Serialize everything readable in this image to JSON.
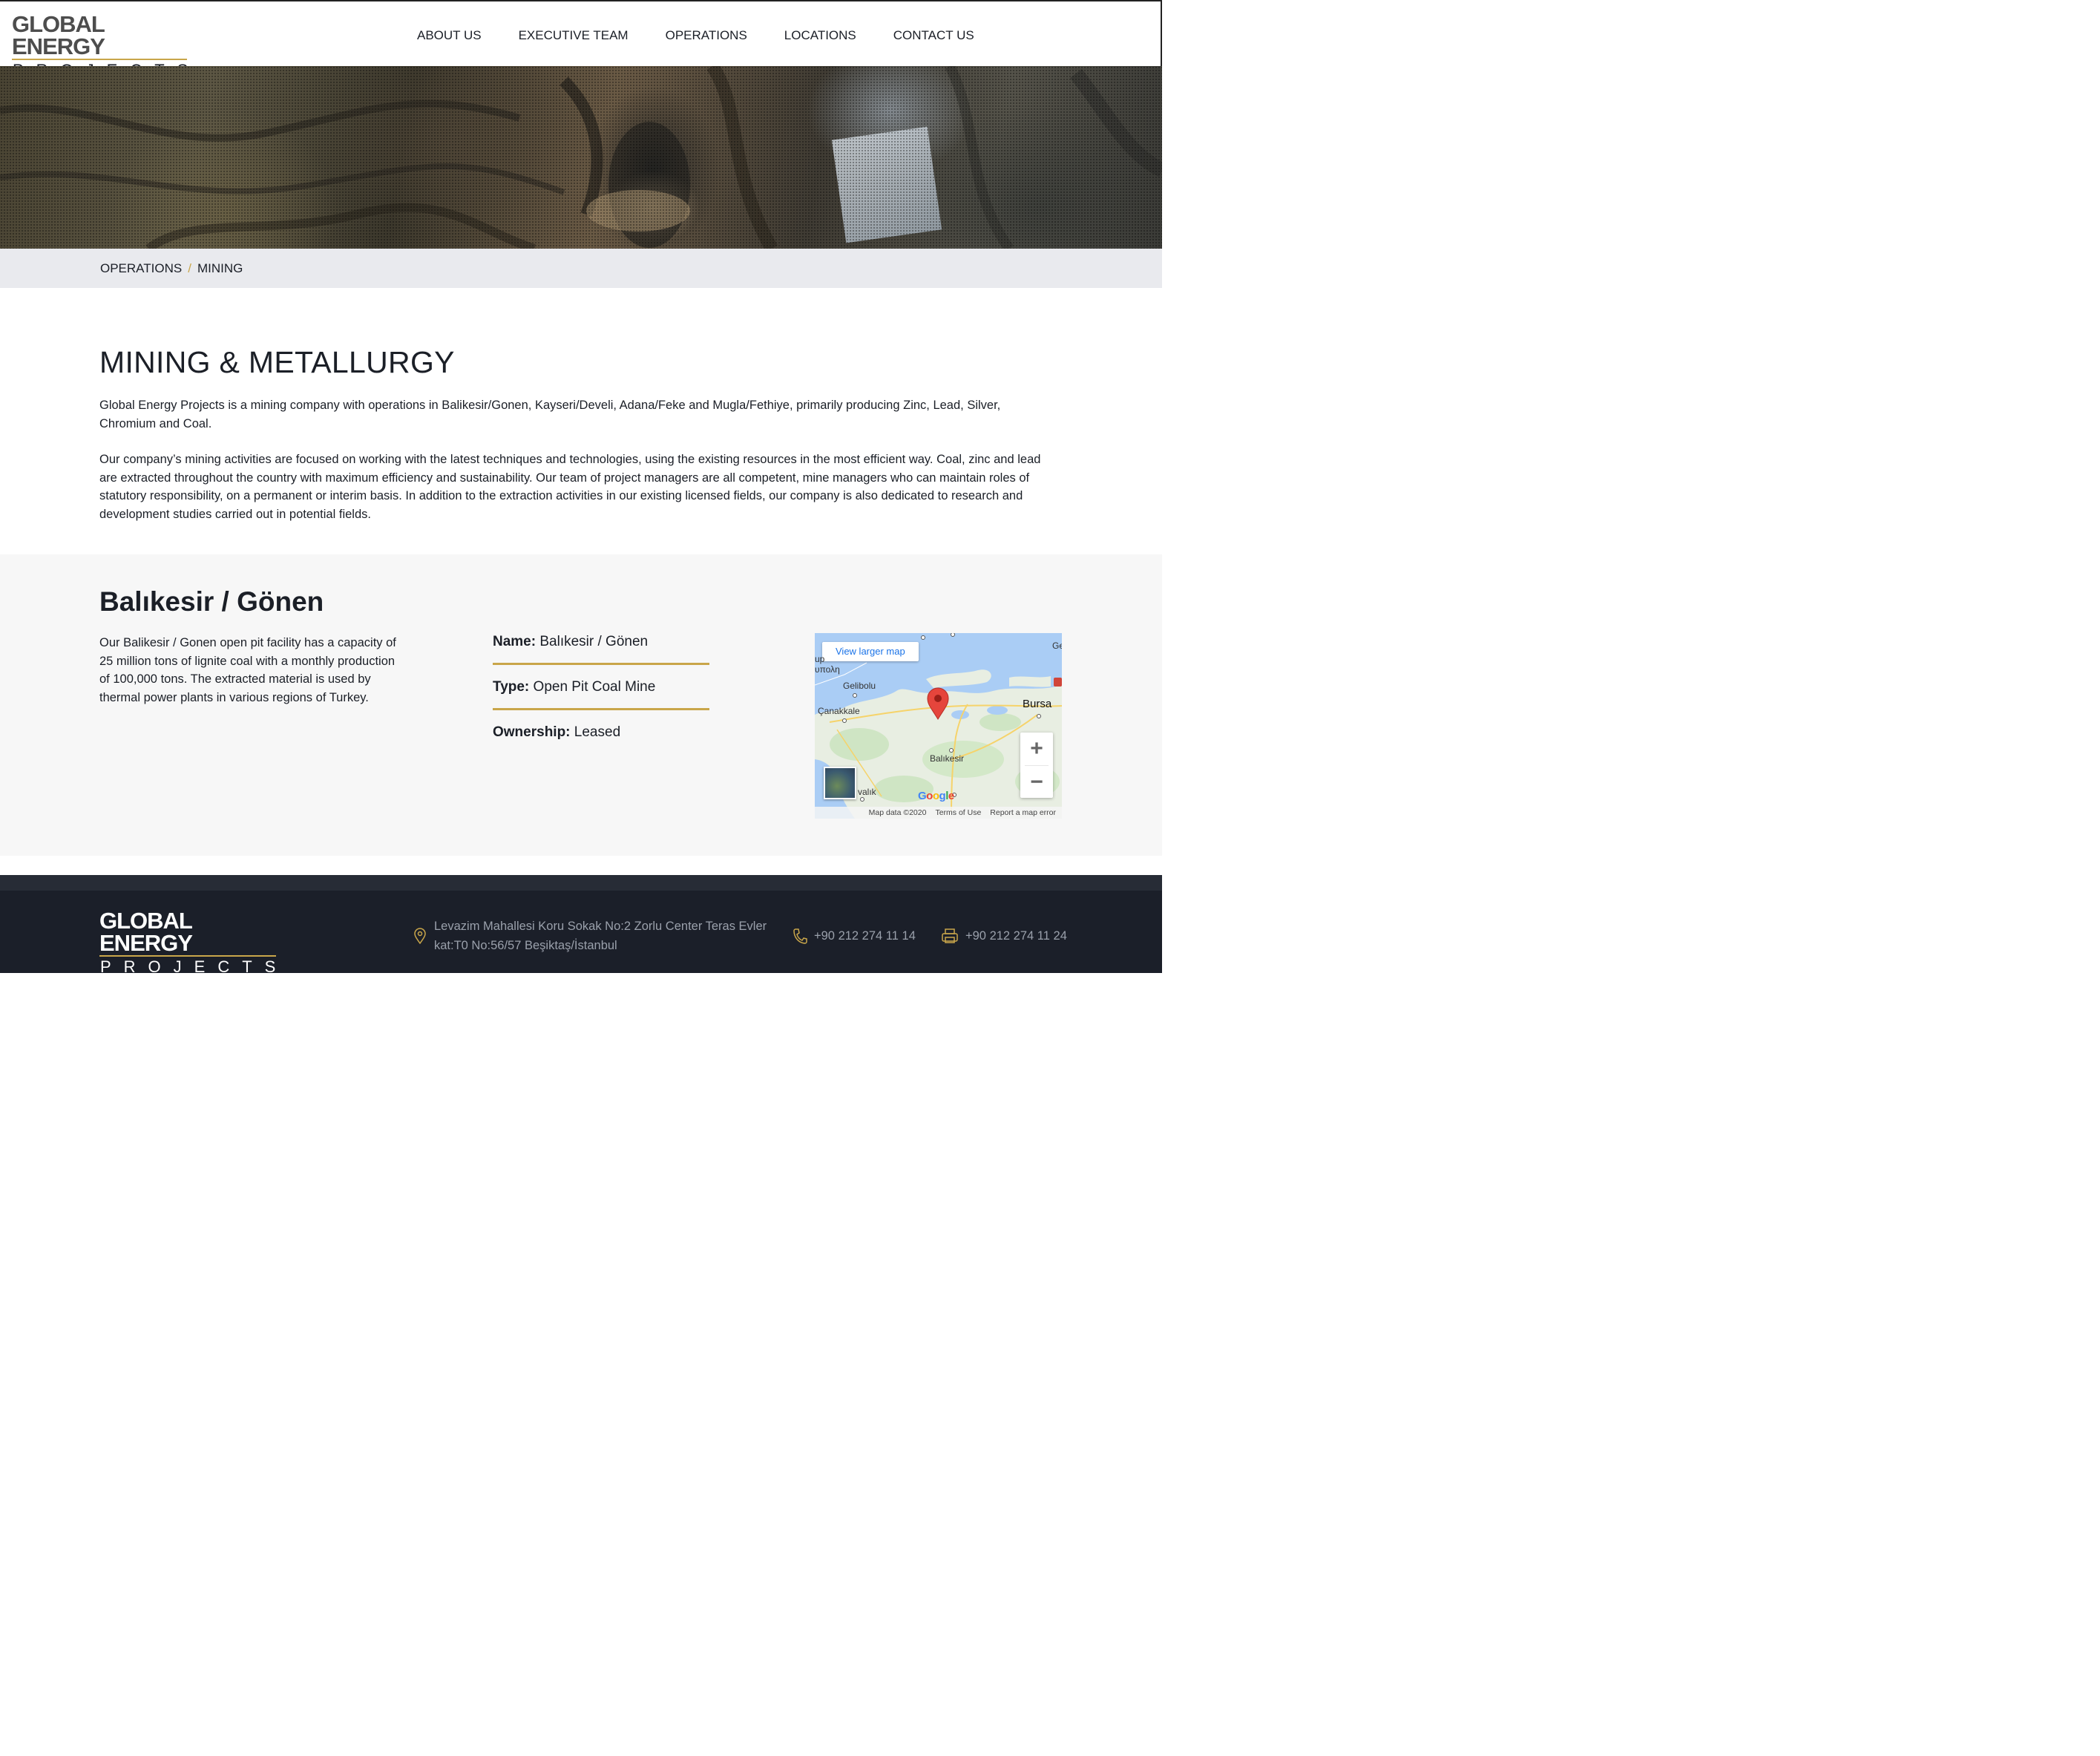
{
  "header": {
    "logo": {
      "top": "GLOBAL ENERGY",
      "bottom": "PROJECTS"
    },
    "nav": [
      "ABOUT US",
      "EXECUTIVE TEAM",
      "OPERATIONS",
      "LOCATIONS",
      "CONTACT US"
    ]
  },
  "breadcrumb": {
    "parent": "OPERATIONS",
    "separator": "/",
    "current": "MINING"
  },
  "intro": {
    "title": "MINING & METALLURGY",
    "paragraph1": "Global Energy Projects is a mining company with operations in Balikesir/Gonen, Kayseri/Develi, Adana/Feke and Mugla/Fethiye, primarily producing Zinc, Lead, Silver, Chromium and Coal.",
    "paragraph2": "Our company’s mining activities are focused on working with the latest techniques and technologies, using the existing resources in the most efficient way. Coal, zinc and lead are extracted throughout the country with maximum efficiency and sustainability. Our team of project managers are all competent, mine managers who can maintain roles of statutory responsibility, on a permanent or interim basis. In addition to the extraction activities in our existing licensed fields, our company is also dedicated to research and development studies carried out in potential fields."
  },
  "location": {
    "title": "Balıkesir / Gönen",
    "description": "Our Balikesir / Gonen open pit facility has a capacity of 25 million tons of lignite coal with a monthly production of 100,000 tons. The extracted material is used by thermal power plants in various regions of Turkey.",
    "facts": [
      {
        "label": "Name:",
        "value": "Balıkesir / Gönen"
      },
      {
        "label": "Type:",
        "value": "Open Pit Coal Mine"
      },
      {
        "label": "Ownership:",
        "value": "Leased"
      }
    ],
    "map": {
      "larger_map_link": "View larger map",
      "labels": {
        "gelibolu": "Gelibolu",
        "canakkale": "Çanakkale",
        "bursa": "Bursa",
        "balikesir": "Balıkesir",
        "ayvalik": "valık",
        "greek": "υπολη",
        "up": "up",
        "ge": "Ge"
      },
      "zoom_in": "+",
      "zoom_out": "−",
      "google": "Google",
      "footer": [
        "Map data ©2020",
        "Terms of Use",
        "Report a map error"
      ]
    }
  },
  "footer": {
    "logo": {
      "top": "GLOBAL ENERGY",
      "bottom": "PROJECTS"
    },
    "address_line1": "Levazim Mahallesi Koru Sokak No:2 Zorlu Center Teras Evler",
    "address_line2": "kat:T0 No:56/57 Beşiktaş/İstanbul",
    "phone": "+90 212 274 11 14",
    "fax": "+90 212 274 11 24",
    "accent_color": "#c9a64a"
  }
}
